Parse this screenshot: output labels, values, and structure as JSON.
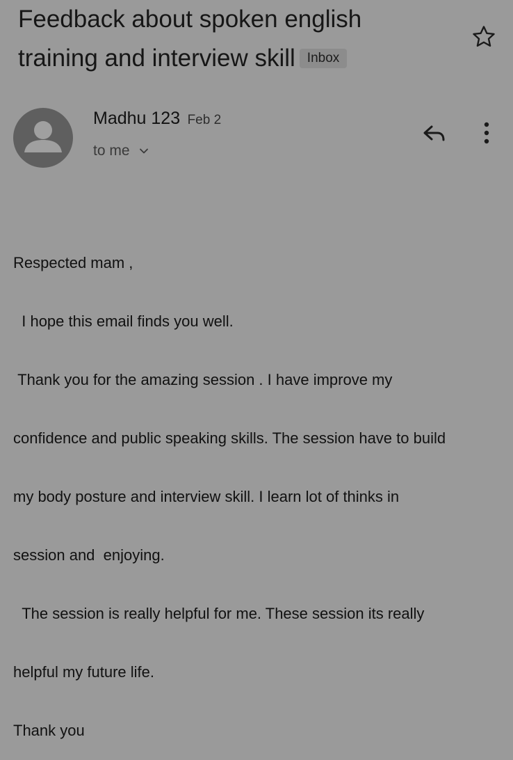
{
  "email": {
    "subject_line1": "Feedback about spoken english",
    "subject_line2": "training and interview skill",
    "label": "Inbox",
    "sender": "Madhu 123",
    "date": "Feb 2",
    "recipient": "to me",
    "body": [
      "Respected mam ,",
      "  I hope this email finds you well.",
      " Thank you for the amazing session . I have improve my",
      "confidence and public speaking skills. The session have to build",
      "my body posture and interview skill. I learn lot of thinks in",
      "session and  enjoying.",
      "  The session is really helpful for me. These session its really",
      "helpful my future life.",
      "Thank you"
    ]
  },
  "icons": {
    "star": "star-icon",
    "avatar": "person-icon",
    "reply": "reply-icon",
    "more": "more-vertical-icon",
    "expand": "chevron-down-icon"
  },
  "colors": {
    "background": "#9a9a9a",
    "avatar_bg": "#5f5f5f",
    "avatar_fg": "#a0a0a0",
    "chip_bg": "#8c8c8c"
  }
}
